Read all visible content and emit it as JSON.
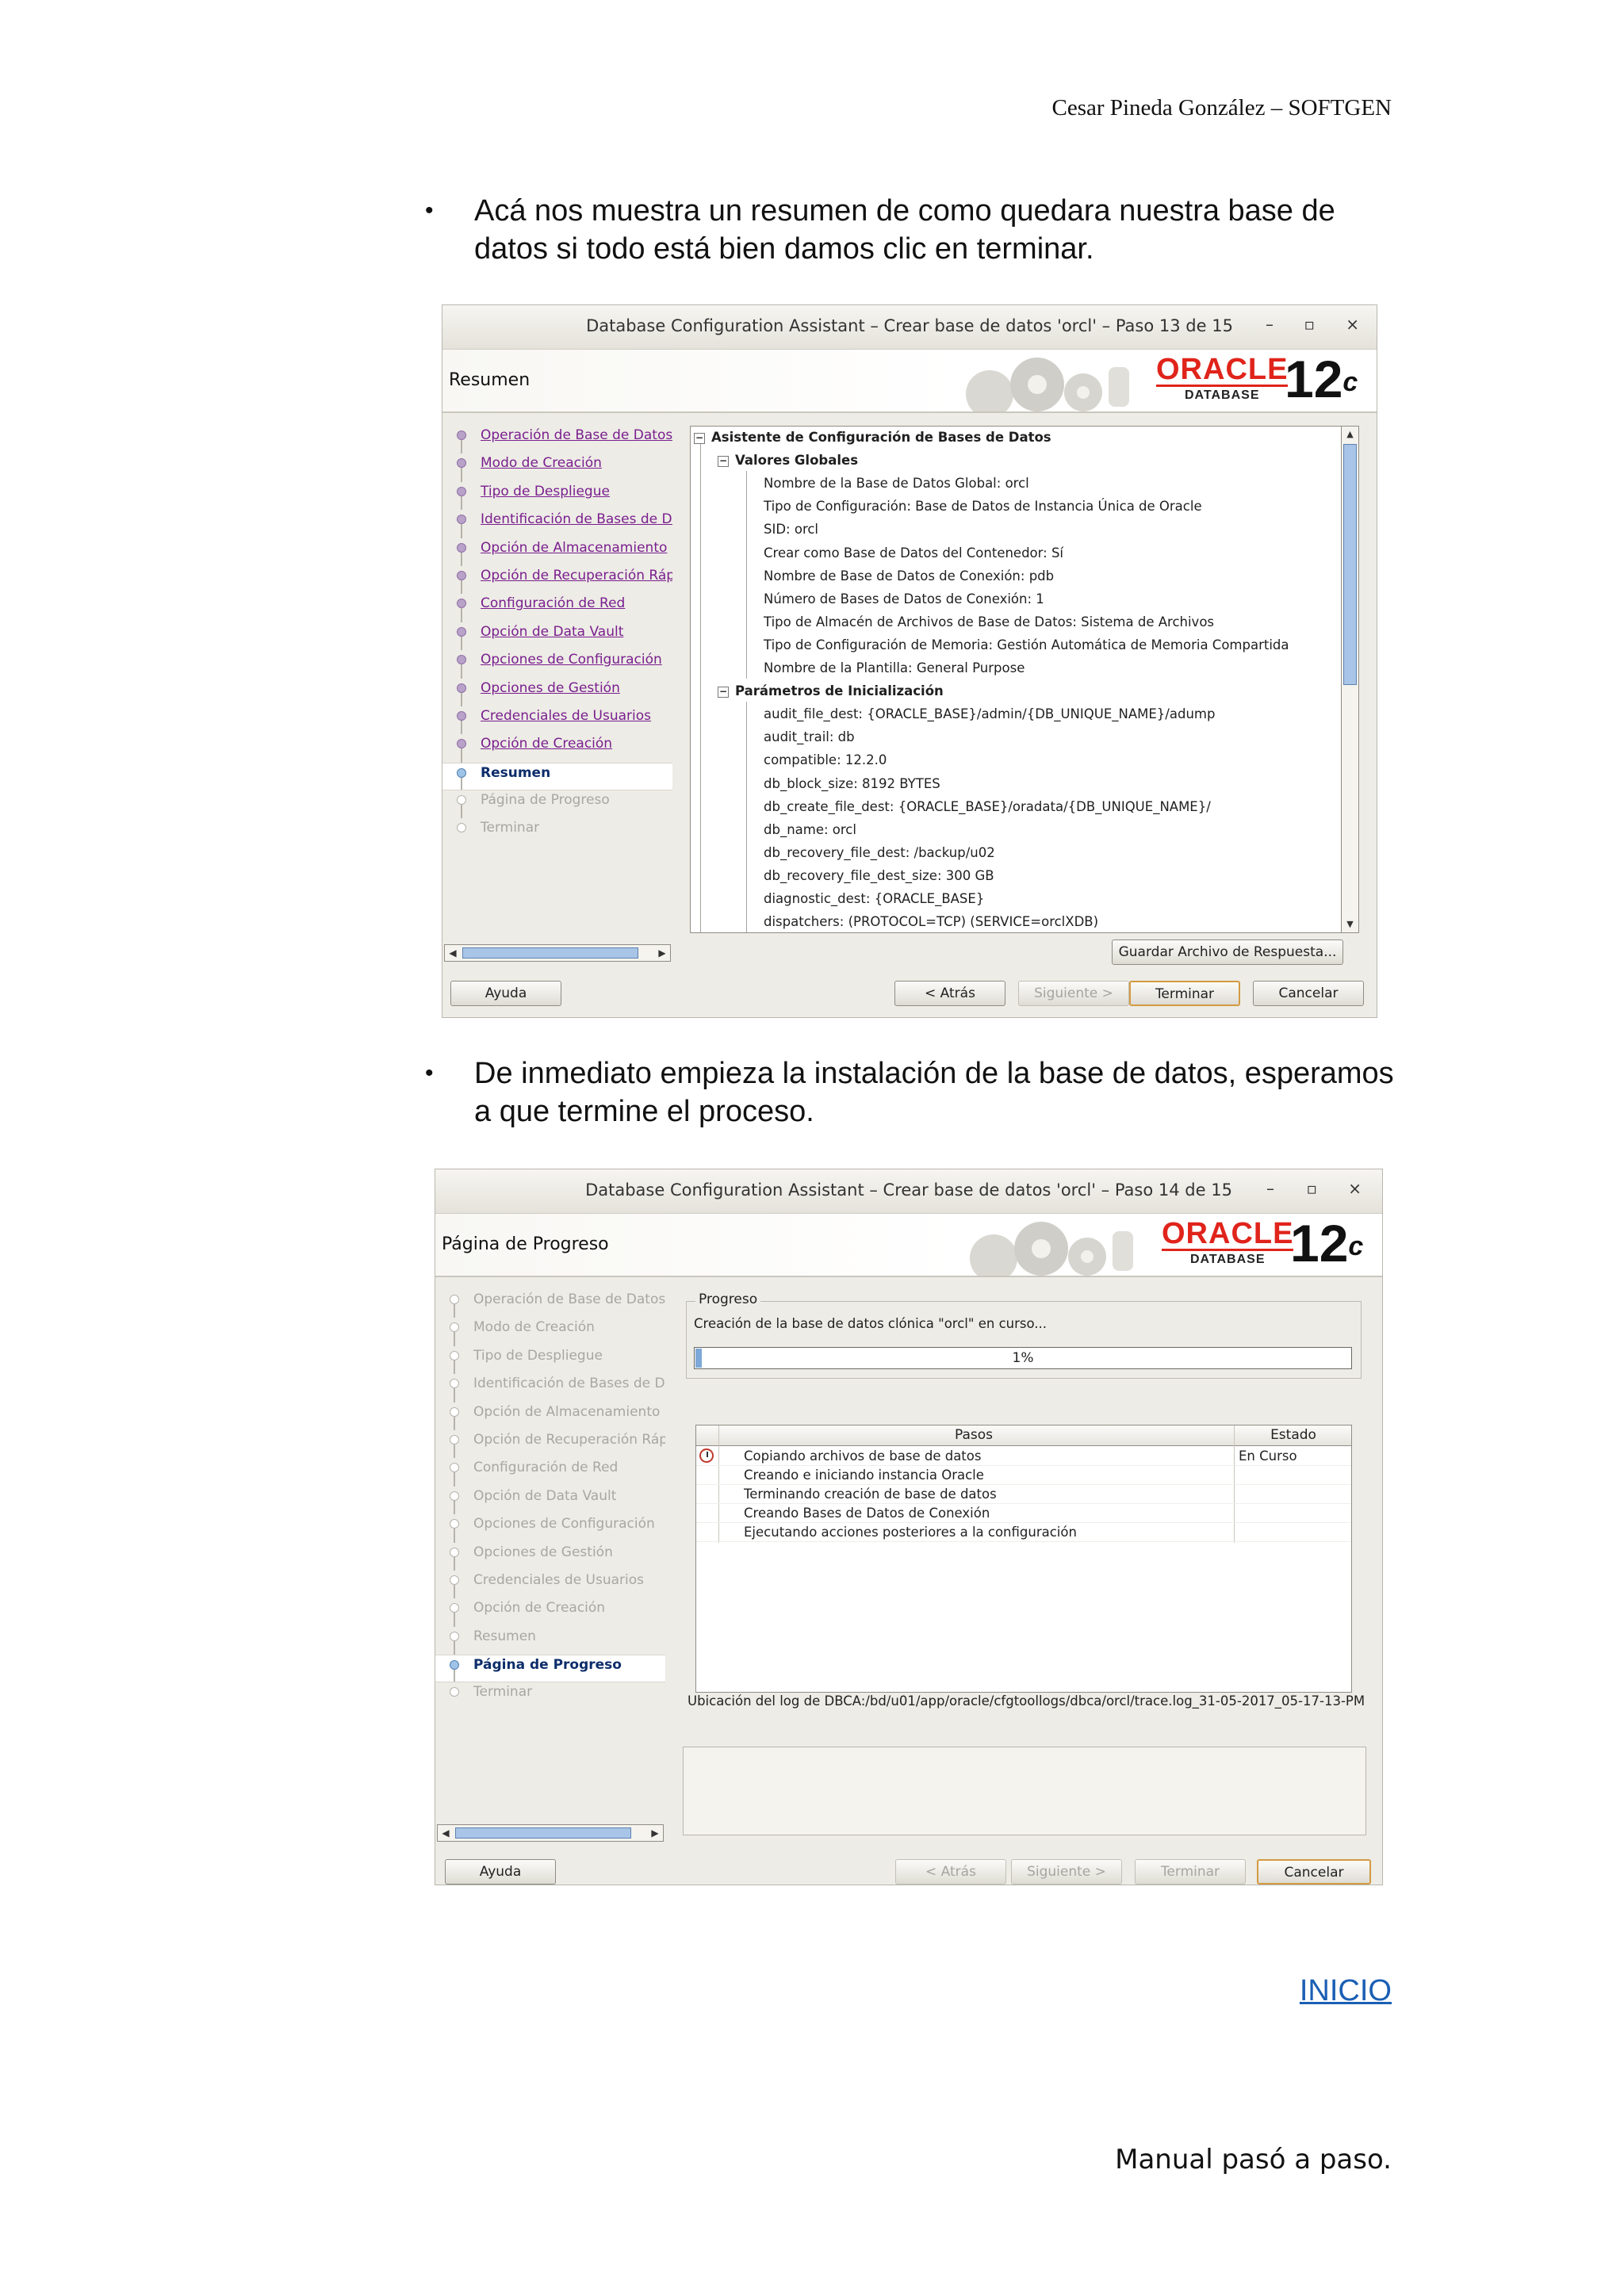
{
  "header": {
    "author": "Cesar Pineda González  –  SOFTGEN"
  },
  "bullets": [
    {
      "symbol": "•",
      "text": "Acá nos muestra un resumen de como quedara nuestra base de datos si todo está bien damos clic en terminar."
    },
    {
      "symbol": "•",
      "text": "De inmediato empieza la instalación de la base de datos, esperamos a que termine el proceso."
    }
  ],
  "window1": {
    "title": "Database Configuration Assistant – Crear base de datos 'orcl' – Paso 13 de 15",
    "controls": {
      "minimize": "–",
      "maximize": "▫",
      "close": "×"
    },
    "page_title": "Resumen",
    "logo": {
      "brand": "ORACLE",
      "product": "DATABASE",
      "version": "12",
      "version_suffix": "c"
    },
    "nav": [
      {
        "label": "Operación de Base de Datos",
        "state": "done"
      },
      {
        "label": "Modo de Creación",
        "state": "done"
      },
      {
        "label": "Tipo de Despliegue",
        "state": "done"
      },
      {
        "label": "Identificación de Bases de Da",
        "state": "done"
      },
      {
        "label": "Opción de Almacenamiento",
        "state": "done"
      },
      {
        "label": "Opción de Recuperación Rápi",
        "state": "done"
      },
      {
        "label": "Configuración de Red",
        "state": "done"
      },
      {
        "label": "Opción de Data Vault",
        "state": "done"
      },
      {
        "label": "Opciones de Configuración",
        "state": "done"
      },
      {
        "label": "Opciones de Gestión",
        "state": "done"
      },
      {
        "label": "Credenciales de Usuarios",
        "state": "done"
      },
      {
        "label": "Opción de Creación",
        "state": "done"
      },
      {
        "label": "Resumen",
        "state": "current"
      },
      {
        "label": "Página de Progreso",
        "state": "off"
      },
      {
        "label": "Terminar",
        "state": "off"
      }
    ],
    "tree": {
      "root": "Asistente de Configuración de Bases de Datos",
      "section1": "Valores Globales",
      "global_values": [
        "Nombre de la Base de Datos Global: orcl",
        "Tipo de Configuración: Base de Datos de Instancia Única de Oracle",
        "SID: orcl",
        "Crear como Base de Datos del Contenedor: Sí",
        "Nombre de Base de Datos de Conexión: pdb",
        "Número de Bases de Datos de Conexión: 1",
        "Tipo de Almacén de Archivos de Base de Datos: Sistema de Archivos",
        "Tipo de Configuración de Memoria: Gestión Automática de Memoria Compartida",
        "Nombre de la Plantilla: General Purpose"
      ],
      "section2": "Parámetros de Inicialización",
      "init_params": [
        "audit_file_dest: {ORACLE_BASE}/admin/{DB_UNIQUE_NAME}/adump",
        "audit_trail: db",
        "compatible: 12.2.0",
        "db_block_size: 8192 BYTES",
        "db_create_file_dest: {ORACLE_BASE}/oradata/{DB_UNIQUE_NAME}/",
        "db_name: orcl",
        "db_recovery_file_dest: /backup/u02",
        "db_recovery_file_dest_size: 300 GB",
        "diagnostic_dest: {ORACLE_BASE}",
        "dispatchers: (PROTOCOL=TCP) (SERVICE=orclXDB)"
      ]
    },
    "save_response_label": "Guardar Archivo de Respuesta...",
    "buttons": {
      "help": "Ayuda",
      "back": "< Atrás",
      "next": "Siguiente >",
      "finish": "Terminar",
      "cancel": "Cancelar"
    }
  },
  "window2": {
    "title": "Database Configuration Assistant – Crear base de datos 'orcl' – Paso 14 de 15",
    "controls": {
      "minimize": "–",
      "maximize": "▫",
      "close": "×"
    },
    "page_title": "Página de Progreso",
    "logo": {
      "brand": "ORACLE",
      "product": "DATABASE",
      "version": "12",
      "version_suffix": "c"
    },
    "nav": [
      {
        "label": "Operación de Base de Datos",
        "state": "off"
      },
      {
        "label": "Modo de Creación",
        "state": "off"
      },
      {
        "label": "Tipo de Despliegue",
        "state": "off"
      },
      {
        "label": "Identificación de Bases de Da",
        "state": "off"
      },
      {
        "label": "Opción de Almacenamiento",
        "state": "off"
      },
      {
        "label": "Opción de Recuperación Rápi",
        "state": "off"
      },
      {
        "label": "Configuración de Red",
        "state": "off"
      },
      {
        "label": "Opción de Data Vault",
        "state": "off"
      },
      {
        "label": "Opciones de Configuración",
        "state": "off"
      },
      {
        "label": "Opciones de Gestión",
        "state": "off"
      },
      {
        "label": "Credenciales de Usuarios",
        "state": "off"
      },
      {
        "label": "Opción de Creación",
        "state": "off"
      },
      {
        "label": "Resumen",
        "state": "off"
      },
      {
        "label": "Página de Progreso",
        "state": "current"
      },
      {
        "label": "Terminar",
        "state": "off"
      }
    ],
    "progress_group_label": "Progreso",
    "progress_status": "Creación de la base de datos clónica \"orcl\" en curso...",
    "progress_percent_value": 1,
    "progress_percent_text": "1%",
    "steps_headers": {
      "name": "Pasos",
      "status": "Estado"
    },
    "steps": [
      {
        "name": "Copiando archivos de base de datos",
        "status": "En Curso"
      },
      {
        "name": "Creando e iniciando instancia Oracle",
        "status": ""
      },
      {
        "name": "Terminando creación de base de datos",
        "status": ""
      },
      {
        "name": "Creando Bases de Datos de Conexión",
        "status": ""
      },
      {
        "name": "Ejecutando acciones posteriores a la configuración",
        "status": ""
      }
    ],
    "log_location": "Ubicación del log de DBCA:/bd/u01/app/oracle/cfgtoollogs/dbca/orcl/trace.log_31-05-2017_05-17-13-PM",
    "buttons": {
      "help": "Ayuda",
      "back": "< Atrás",
      "next": "Siguiente >",
      "finish": "Terminar",
      "cancel": "Cancelar"
    }
  },
  "link_inicio": "INICIO",
  "footer": "Manual pasó a paso."
}
